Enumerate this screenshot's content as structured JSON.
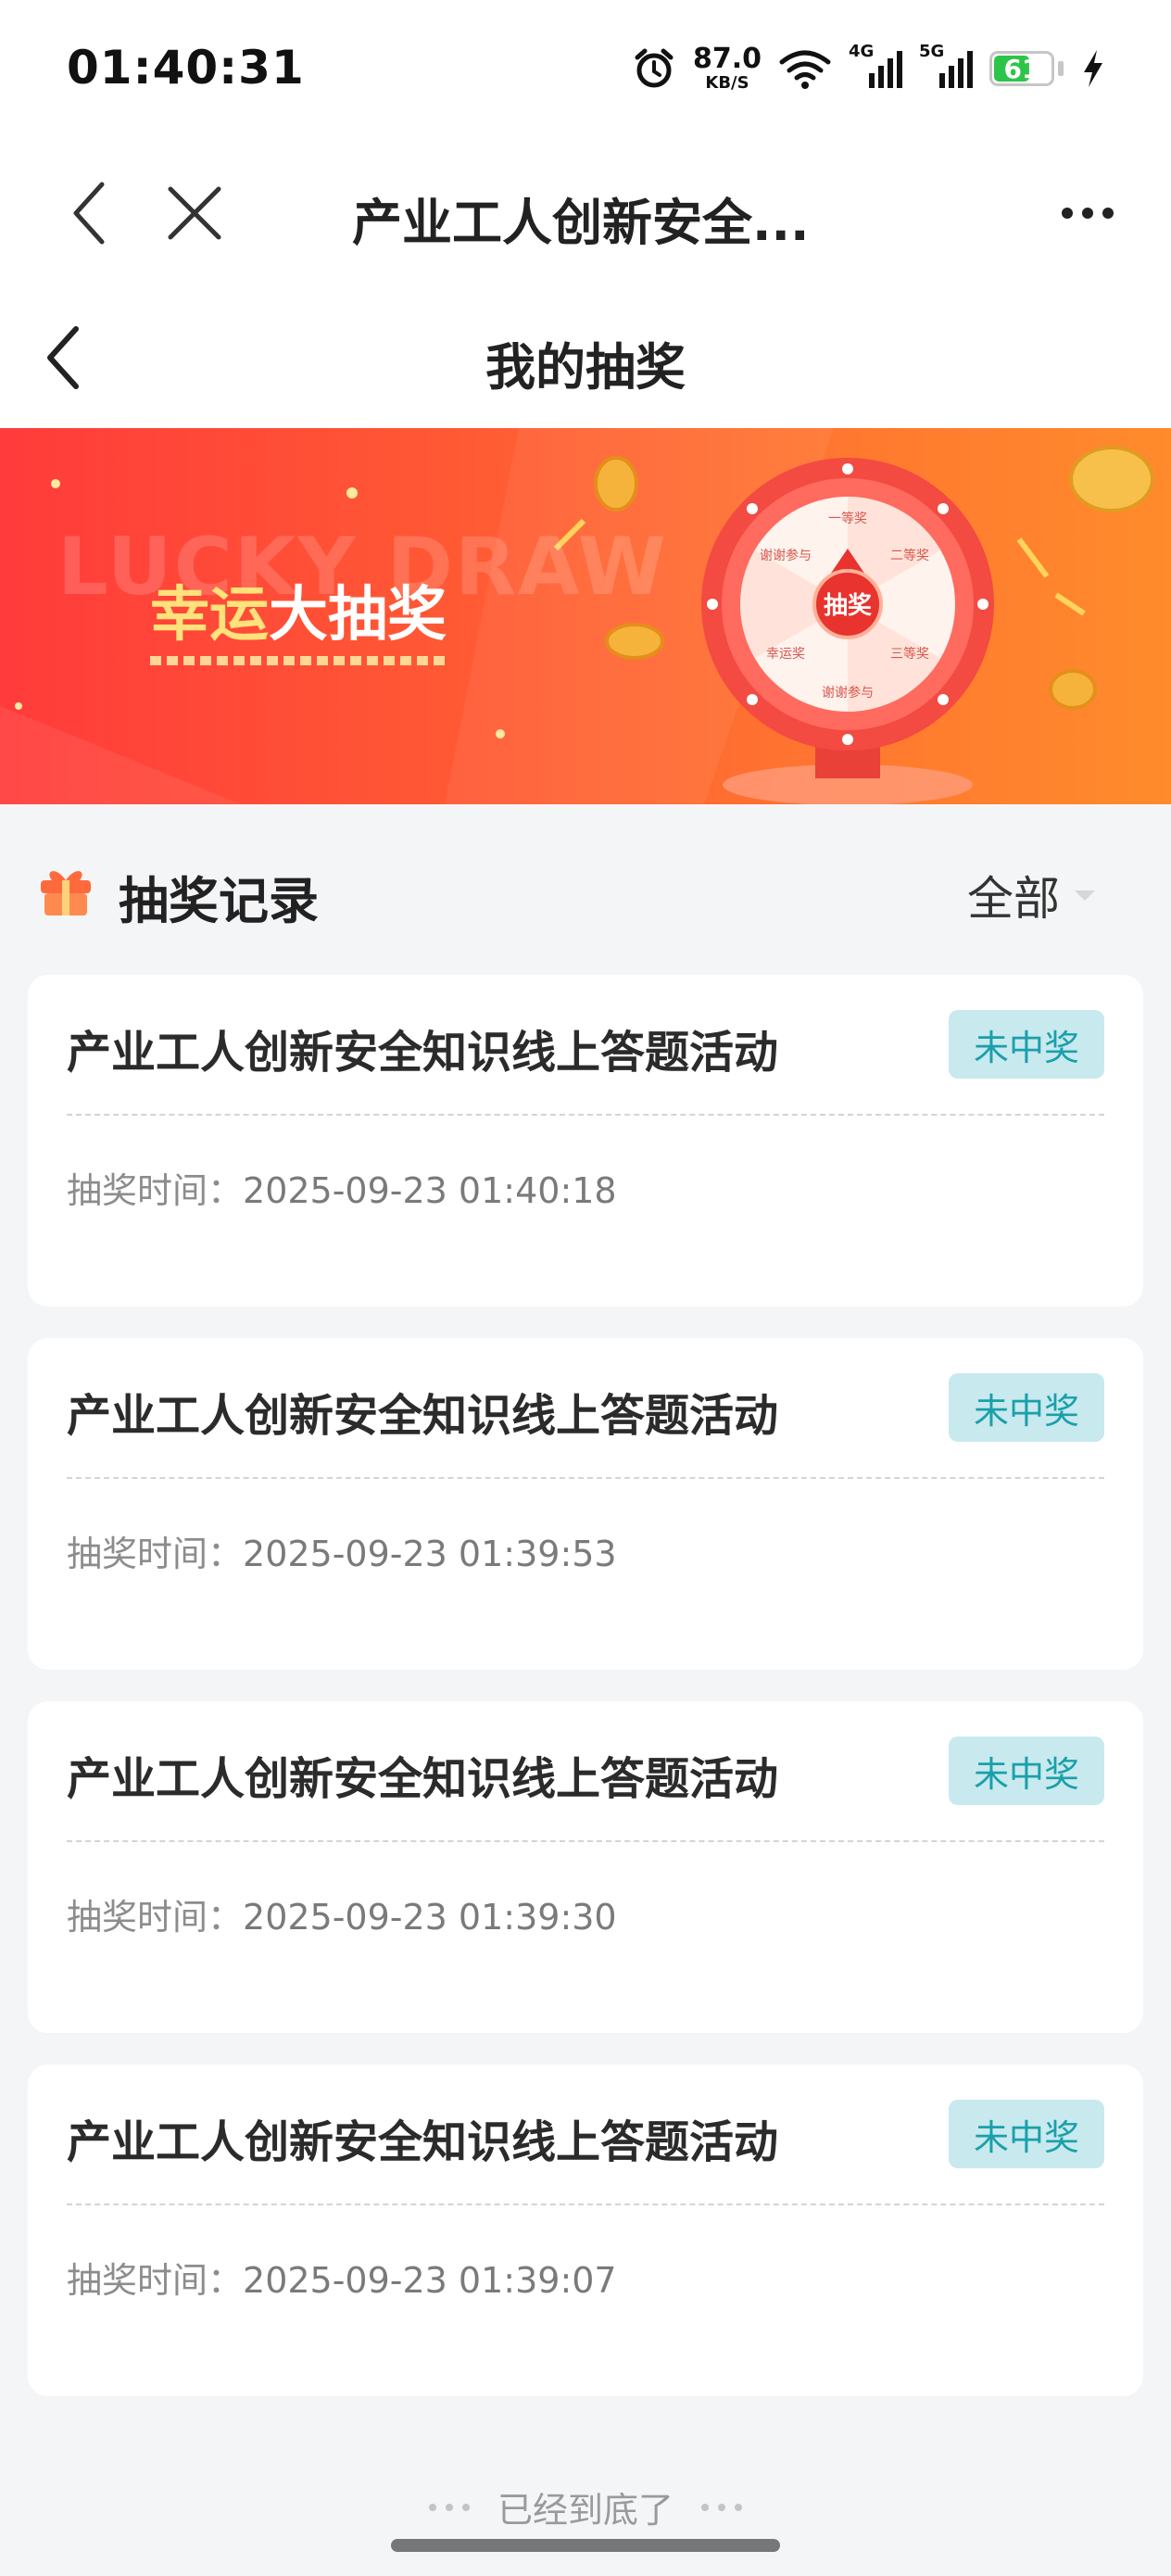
{
  "status_bar": {
    "time": "01:40:31",
    "net_speed_value": "87.0",
    "net_speed_unit": "KB/S",
    "signal_1_label": "4G",
    "signal_2_label": "5G",
    "battery_level": "61",
    "icons": [
      "alarm-icon",
      "wifi-icon",
      "signal-icon",
      "battery-icon",
      "charging-bolt-icon"
    ]
  },
  "app_bar": {
    "title": "产业工人创新安全...",
    "icons": [
      "chevron-left-icon",
      "close-icon",
      "more-dots-icon"
    ]
  },
  "page_header": {
    "title": "我的抽奖"
  },
  "banner": {
    "bg_text": "LUCKY DRAW",
    "headline_highlight": "幸运",
    "headline_rest": "大抽奖",
    "wheel_center": "抽奖",
    "wheel_labels": [
      "一等奖",
      "二等奖",
      "三等奖",
      "谢谢参与",
      "幸运奖",
      "谢谢参与"
    ]
  },
  "records": {
    "section_title": "抽奖记录",
    "filter_label": "全部",
    "time_label": "抽奖时间：",
    "items": [
      {
        "name": "产业工人创新安全知识线上答题活动",
        "status": "未中奖",
        "time": "2025-09-23 01:40:18"
      },
      {
        "name": "产业工人创新安全知识线上答题活动",
        "status": "未中奖",
        "time": "2025-09-23 01:39:53"
      },
      {
        "name": "产业工人创新安全知识线上答题活动",
        "status": "未中奖",
        "time": "2025-09-23 01:39:30"
      },
      {
        "name": "产业工人创新安全知识线上答题活动",
        "status": "未中奖",
        "time": "2025-09-23 01:39:07"
      }
    ]
  },
  "footer": {
    "end_text": "已经到底了"
  },
  "colors": {
    "banner_start": "#ff3b3b",
    "banner_end": "#ff8b2c",
    "badge_bg": "#c8e9ee",
    "badge_text": "#1aa0aa",
    "page_bg": "#f4f5f7"
  }
}
